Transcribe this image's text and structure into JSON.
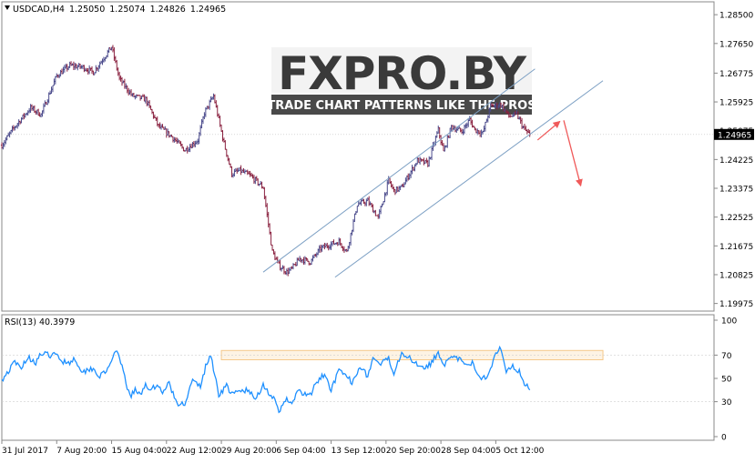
{
  "chart_data": [
    {
      "type": "candlestick",
      "symbol_header": "USDCAD,H4",
      "ohlc_header": [
        "1.25050",
        "1.25074",
        "1.24826",
        "1.24965"
      ],
      "current_price": 1.24965,
      "current_price_label": "1.24965",
      "ylim": [
        1.1975,
        1.2888
      ],
      "y_ticks": [
        1.285,
        1.2765,
        1.26775,
        1.25925,
        1.25075,
        1.24225,
        1.23375,
        1.22525,
        1.21675,
        1.20825,
        1.19975
      ],
      "y_tick_labels": [
        "1.28500",
        "1.27650",
        "1.26775",
        "1.25925",
        "1.25075",
        "1.24225",
        "1.23375",
        "1.22525",
        "1.21675",
        "1.20825",
        "1.19975"
      ],
      "x_labels": [
        "31 Jul 2017",
        "7 Aug 20:00",
        "15 Aug 04:00",
        "22 Aug 12:00",
        "29 Aug 20:00",
        "6 Sep 04:00",
        "13 Sep 12:00",
        "20 Sep 20:00",
        "28 Sep 04:00",
        "5 Oct 12:00"
      ],
      "x_label_bars": [
        0,
        42,
        84,
        126,
        168,
        210,
        252,
        294,
        336,
        378
      ],
      "series_anchors": {
        "bar_index": [
          0,
          10,
          22,
          30,
          42,
          52,
          62,
          70,
          84,
          90,
          100,
          110,
          120,
          130,
          140,
          150,
          155,
          162,
          166,
          170,
          176,
          182,
          190,
          200,
          207,
          212,
          218,
          222,
          228,
          236,
          244,
          250,
          258,
          264,
          272,
          280,
          288,
          296,
          300,
          306,
          312,
          318,
          326,
          334,
          338,
          344,
          352,
          358,
          362,
          368,
          374,
          382,
          388,
          394,
          400,
          404
        ],
        "close": [
          1.2465,
          1.252,
          1.2575,
          1.2555,
          1.267,
          1.27,
          1.2695,
          1.268,
          1.2755,
          1.266,
          1.261,
          1.26,
          1.252,
          1.249,
          1.245,
          1.248,
          1.256,
          1.261,
          1.254,
          1.247,
          1.238,
          1.239,
          1.2375,
          1.234,
          1.215,
          1.211,
          1.209,
          1.21,
          1.213,
          1.212,
          1.216,
          1.217,
          1.218,
          1.215,
          1.229,
          1.23,
          1.225,
          1.236,
          1.233,
          1.234,
          1.238,
          1.242,
          1.241,
          1.251,
          1.2445,
          1.252,
          1.2505,
          1.254,
          1.251,
          1.25,
          1.258,
          1.2585,
          1.255,
          1.2555,
          1.251,
          1.24965
        ]
      },
      "channel": {
        "upper_line": {
          "p1": {
            "bar": 200,
            "price": 1.209
          },
          "p2": {
            "bar": 408,
            "price": 1.269
          }
        },
        "lower_line": {
          "p1": {
            "bar": 255,
            "price": 1.2075
          },
          "p2": {
            "bar": 460,
            "price": 1.2655
          }
        }
      },
      "annotation_arrows": {
        "color": "#f05a5a",
        "segments": [
          {
            "from": {
              "bar": 410,
              "price": 1.248
            },
            "to": {
              "bar": 427,
              "price": 1.2535
            }
          },
          {
            "from": {
              "bar": 430,
              "price": 1.2538
            },
            "to": {
              "bar": 443,
              "price": 1.2345
            }
          }
        ]
      },
      "total_bars": 545,
      "watermark": {
        "main": "FXPRO.BY",
        "tagline": "TRADE CHART PATTERNS LIKE THE PROS"
      },
      "colors": {
        "bull": "#4b4b8c",
        "bear": "#8a2240",
        "line": "#7da0c4",
        "current_price_box": "#000000"
      }
    },
    {
      "type": "line",
      "title": "RSI(13) 40.3979",
      "ylim": [
        0,
        100
      ],
      "y_ticks": [
        0,
        30,
        50,
        70,
        100
      ],
      "y_tick_labels": [
        "0",
        "30",
        "50",
        "70",
        "100"
      ],
      "series": [
        {
          "bar_index": [
            0,
            5,
            10,
            14,
            20,
            26,
            30,
            36,
            42,
            46,
            52,
            56,
            62,
            66,
            70,
            74,
            80,
            84,
            88,
            92,
            98,
            102,
            106,
            110,
            114,
            118,
            124,
            128,
            134,
            140,
            146,
            152,
            156,
            160,
            166,
            172,
            176,
            182,
            188,
            194,
            200,
            204,
            208,
            212,
            218,
            222,
            226,
            230,
            236,
            240,
            246,
            252,
            258,
            262,
            268,
            274,
            280,
            284,
            290,
            296,
            300,
            306,
            312,
            316,
            322,
            328,
            334,
            338,
            344,
            350,
            356,
            360,
            366,
            372,
            378,
            382,
            386,
            390,
            396,
            400,
            404
          ],
          "values": [
            49,
            56,
            64,
            59,
            68,
            64,
            71,
            70,
            70,
            65,
            64,
            67,
            55,
            58,
            59,
            52,
            55,
            67,
            72,
            60,
            34,
            40,
            35,
            46,
            38,
            45,
            38,
            47,
            27,
            29,
            48,
            43,
            60,
            70,
            36,
            44,
            36,
            39,
            40,
            32,
            45,
            38,
            33,
            20,
            34,
            26,
            40,
            36,
            36,
            44,
            53,
            41,
            56,
            53,
            47,
            61,
            52,
            67,
            62,
            67,
            55,
            73,
            67,
            64,
            60,
            62,
            73,
            62,
            67,
            67,
            60,
            63,
            51,
            52,
            73,
            76,
            57,
            61,
            56,
            46,
            40
          ]
        }
      ],
      "highlight_box": {
        "y_range": [
          66,
          74
        ],
        "bar_range": [
          168,
          460
        ],
        "color": "#f5c88a"
      },
      "colors": {
        "line": "#1e90ff"
      }
    }
  ]
}
